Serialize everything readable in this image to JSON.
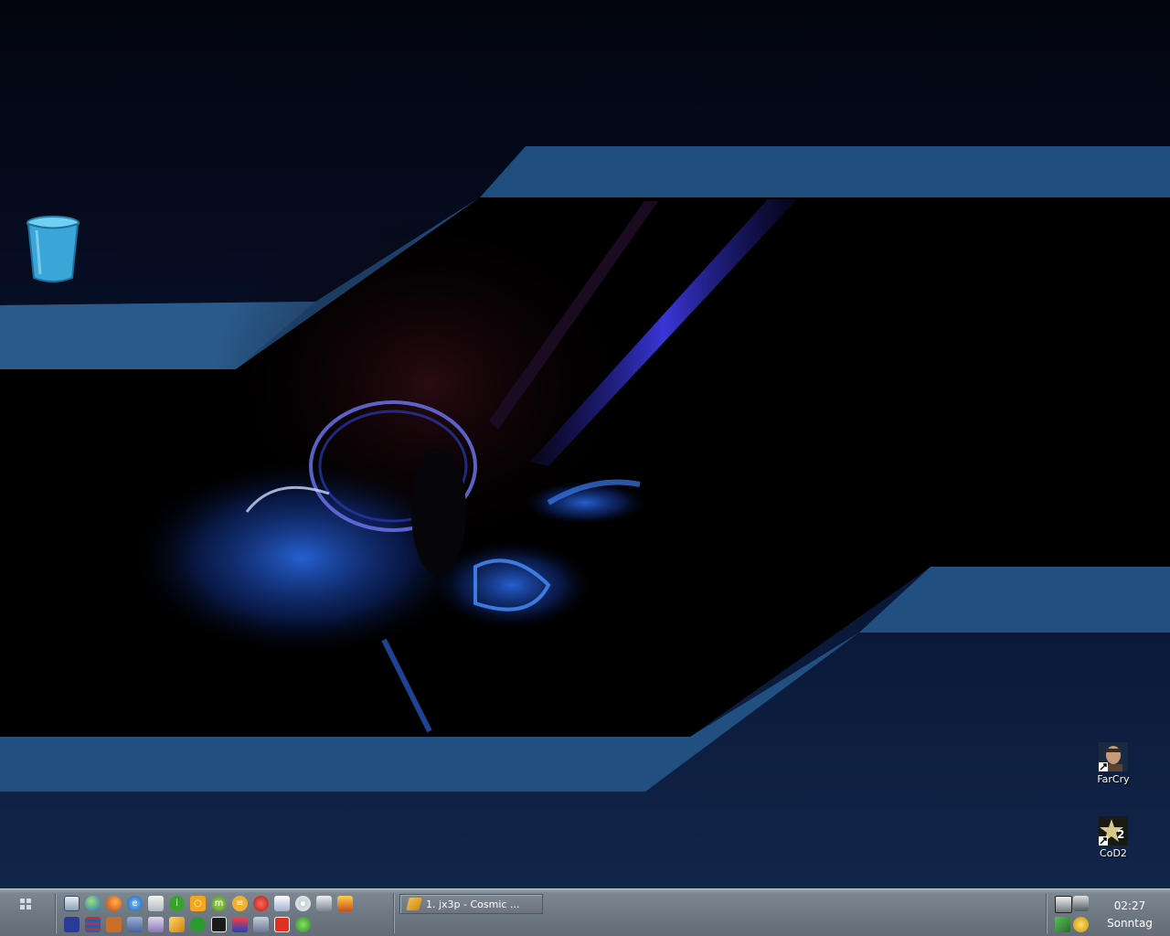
{
  "desktop": {
    "icons": [
      {
        "name": "recycle-bin",
        "label": ""
      },
      {
        "name": "farcry",
        "label": "FarCry"
      },
      {
        "name": "cod2",
        "label": "CoD2"
      }
    ]
  },
  "taskbar": {
    "quick_launch_row1": [
      "my-computer-icon",
      "globe-icon",
      "firefox-icon",
      "internet-explorer-icon",
      "mail-icon",
      "info-icon",
      "search-icon",
      "messenger-icon",
      "notes-icon",
      "tomato-icon",
      "printer-icon",
      "cd-icon",
      "arrow-icon",
      "gift-icon"
    ],
    "quick_launch_row2": [
      "floppy-icon",
      "archive-icon",
      "media-icon",
      "tools-icon",
      "paint-icon",
      "pencil-icon",
      "clover-pro-icon",
      "tv-icon",
      "network-icon",
      "headphones-icon",
      "record-icon",
      "pin-icon"
    ],
    "task_button": {
      "label": "1. jx3p - Cosmic ..."
    },
    "tray": {
      "icons": [
        "monitor-tray-icon",
        "camera-tray-icon",
        "network-tray-icon",
        "messenger-tray-icon"
      ],
      "time": "02:27",
      "day": "Sonntag"
    }
  }
}
